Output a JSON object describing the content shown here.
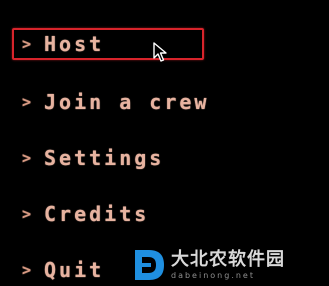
{
  "menu": {
    "items": [
      {
        "chevron": ">",
        "label": "Host",
        "selected": true
      },
      {
        "chevron": ">",
        "label": "Join a crew",
        "selected": false
      },
      {
        "chevron": ">",
        "label": "Settings",
        "selected": false
      },
      {
        "chevron": ">",
        "label": "Credits",
        "selected": false
      },
      {
        "chevron": ">",
        "label": "Quit",
        "selected": false
      }
    ]
  },
  "watermark": {
    "name": "大北农软件园",
    "url": "dabeinong.net"
  },
  "colors": {
    "background": "#000000",
    "text": "#e7b3a0",
    "selection_border": "#d8242b",
    "watermark_logo": "#1f8fe0"
  },
  "icons": {
    "cursor": "mouse-pointer-icon",
    "item_marker": "chevron-right-icon",
    "watermark_logo": "watermark-logo-icon"
  }
}
